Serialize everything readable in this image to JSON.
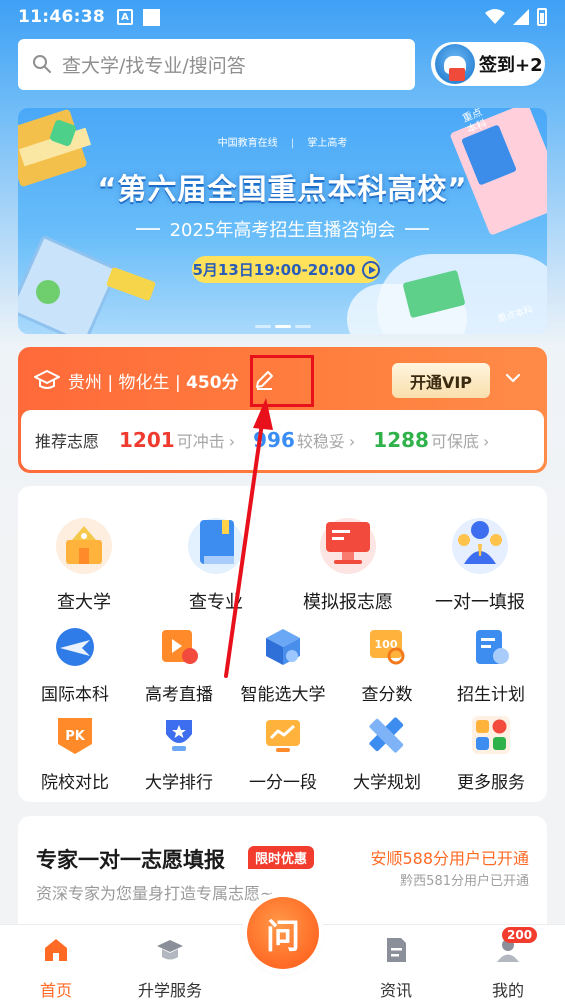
{
  "status_bar": {
    "time": "11:46:38",
    "a_label": "A"
  },
  "search": {
    "placeholder": "查大学/找专业/搜问答",
    "checkin": "签到+2"
  },
  "banner": {
    "logo_left": "中国教育在线",
    "logo_right": "掌上高考",
    "title": "“第六届全国重点本科高校”",
    "subtitle": "2025年高考招生直播咨询会",
    "time": "5月13日19:00-20:00",
    "book_label": "重点本科",
    "book_label2": "重点本科"
  },
  "score_card": {
    "province": "贵州",
    "subjects": "物化生",
    "score": "450分",
    "vip_label": "开通VIP",
    "rec_label": "推荐志愿",
    "items": [
      {
        "num": "1201",
        "desc": "可冲击",
        "color": "#ef3b2f"
      },
      {
        "num": "996",
        "desc": "较稳妥",
        "color": "#3a8df5"
      },
      {
        "num": "1288",
        "desc": "可保底",
        "color": "#2fb24a"
      }
    ]
  },
  "services": {
    "big": [
      {
        "label": "查大学",
        "icon": "school-icon"
      },
      {
        "label": "查专业",
        "icon": "book-icon"
      },
      {
        "label": "模拟报志愿",
        "icon": "monitor-icon"
      },
      {
        "label": "一对一填报",
        "icon": "advisor-icon"
      }
    ],
    "row2": [
      {
        "label": "国际本科",
        "icon": "plane-icon"
      },
      {
        "label": "高考直播",
        "icon": "live-icon"
      },
      {
        "label": "智能选大学",
        "icon": "cube-icon"
      },
      {
        "label": "查分数",
        "icon": "score-icon"
      },
      {
        "label": "招生计划",
        "icon": "plan-icon"
      }
    ],
    "row3": [
      {
        "label": "院校对比",
        "icon": "pk-icon"
      },
      {
        "label": "大学排行",
        "icon": "trophy-icon"
      },
      {
        "label": "一分一段",
        "icon": "chart-icon"
      },
      {
        "label": "大学规划",
        "icon": "ruler-icon"
      },
      {
        "label": "更多服务",
        "icon": "grid-icon"
      }
    ]
  },
  "expert": {
    "title": "专家一对一志愿填报",
    "badge": "限时优惠",
    "subtitle": "资深专家为您量身打造专属志愿~",
    "notice1": "安顺588分用户已开通",
    "notice2": "黔西581分用户已开通"
  },
  "bottom_nav": {
    "home": "首页",
    "service": "升学服务",
    "center": "问",
    "news": "资讯",
    "mine": "我的",
    "badge": "200"
  },
  "colors": {
    "accent": "#ff6a25",
    "primary": "#3ea0f5",
    "highlight": "#e8101a"
  }
}
